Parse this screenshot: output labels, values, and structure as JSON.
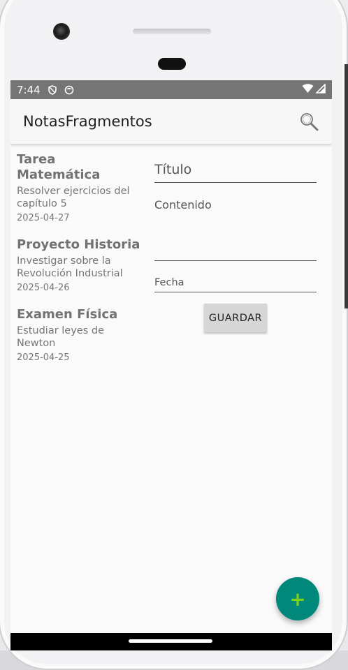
{
  "status_bar": {
    "time": "7:44",
    "icons": [
      "shield-icon",
      "face-icon"
    ],
    "right_icons": [
      "wifi-icon",
      "signal-icon"
    ]
  },
  "app_bar": {
    "title": "NotasFragmentos",
    "search_icon": "search-icon"
  },
  "notes": [
    {
      "title": "Tarea Matemática",
      "body": "Resolver ejercicios del capítulo 5",
      "date": "2025-04-27"
    },
    {
      "title": "Proyecto Historia",
      "body": "Investigar sobre la Revolución Industrial",
      "date": "2025-04-26"
    },
    {
      "title": "Examen Física",
      "body": "Estudiar leyes de Newton",
      "date": "2025-04-25"
    }
  ],
  "form": {
    "title_placeholder": "Título",
    "content_placeholder": "Contenido",
    "date_placeholder": "Fecha",
    "save_label": "GUARDAR"
  },
  "fab": {
    "icon": "plus-icon",
    "label": "+"
  },
  "colors": {
    "accent": "#00897b",
    "fab_icon": "#7bd11f",
    "status_bar": "#757575"
  }
}
